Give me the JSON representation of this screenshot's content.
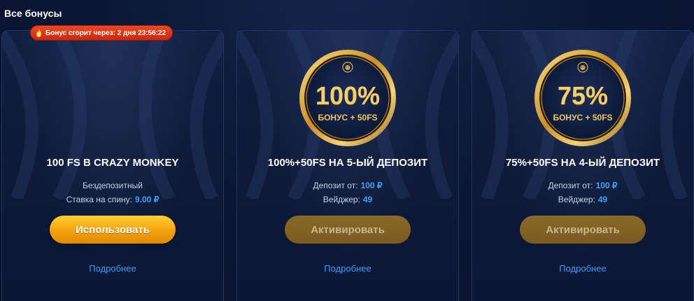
{
  "section_title": "Все бонусы",
  "colors": {
    "accent_gold": "#f4a20d",
    "link_blue": "#3a9cff",
    "badge_red": "#d8300f",
    "background": "#0a1530"
  },
  "cards": [
    {
      "timer_badge": {
        "icon": "fire-icon",
        "text": "Бонус сгорит через: 2 дня 23:56:22"
      },
      "title": "100 FS В CRAZY MONKEY",
      "line1": {
        "label": "Бездепозитный",
        "value": ""
      },
      "line2": {
        "label": "Ставка на спину:",
        "value": "9.00 ₽"
      },
      "button": {
        "label": "Использовать",
        "state": "active"
      },
      "more_link": "Подробнее"
    },
    {
      "medal": {
        "icon": "lion-icon",
        "big": "100%",
        "small": "БОНУС + 50FS"
      },
      "title": "100%+50FS НА 5-ЫЙ ДЕПОЗИТ",
      "line1": {
        "label": "Депозит от:",
        "value": "100 ₽"
      },
      "line2": {
        "label": "Вейджер:",
        "value": "49"
      },
      "button": {
        "label": "Активировать",
        "state": "disabled"
      },
      "more_link": "Подробнее"
    },
    {
      "medal": {
        "icon": "lion-icon",
        "big": "75%",
        "small": "БОНУС + 50FS"
      },
      "title": "75%+50FS НА 4-ЫЙ ДЕПОЗИТ",
      "line1": {
        "label": "Депозит от:",
        "value": "100 ₽"
      },
      "line2": {
        "label": "Вейджер:",
        "value": "49"
      },
      "button": {
        "label": "Активировать",
        "state": "disabled"
      },
      "more_link": "Подробнее"
    }
  ]
}
